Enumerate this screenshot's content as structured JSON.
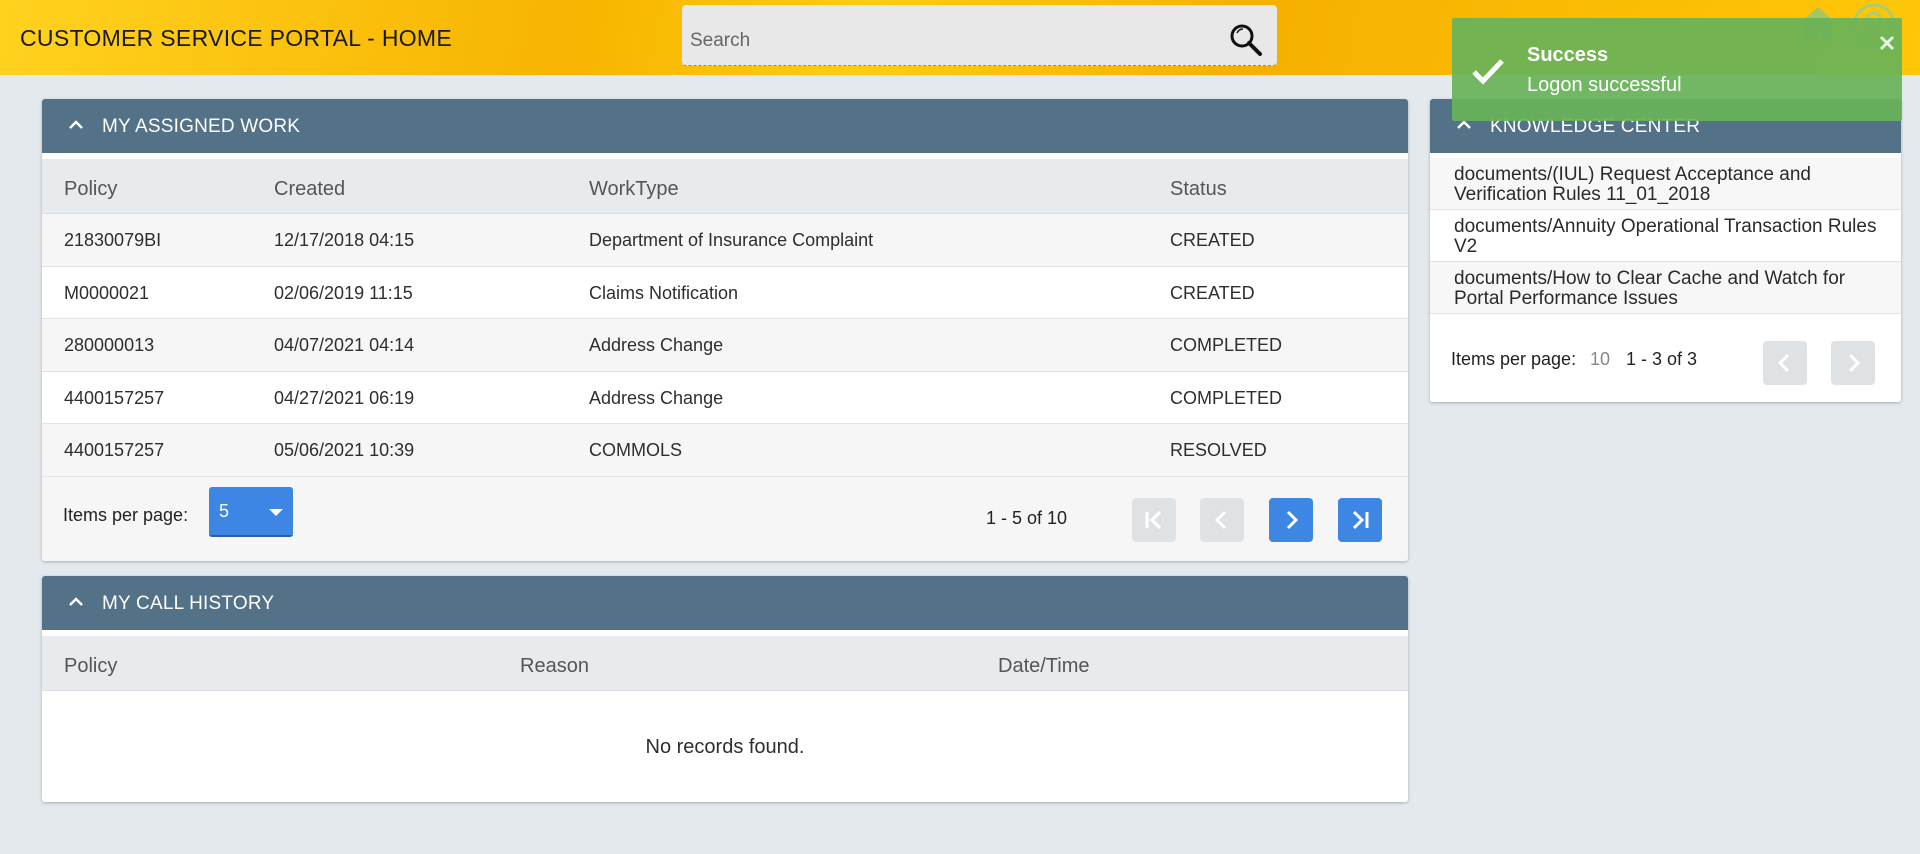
{
  "header": {
    "title": "CUSTOMER SERVICE PORTAL - HOME",
    "search_placeholder": "Search",
    "icons": [
      "search-icon",
      "home-icon",
      "user-icon"
    ]
  },
  "assigned_work": {
    "title": "MY ASSIGNED WORK",
    "columns": [
      "Policy",
      "Created",
      "WorkType",
      "Status"
    ],
    "rows": [
      [
        "21830079BI",
        "12/17/2018 04:15",
        "Department of Insurance Complaint",
        "CREATED"
      ],
      [
        "M0000021",
        "02/06/2019 11:15",
        "Claims Notification",
        "CREATED"
      ],
      [
        "280000013",
        "04/07/2021 04:14",
        "Address Change",
        "COMPLETED"
      ],
      [
        "4400157257",
        "04/27/2021 06:19",
        "Address Change",
        "COMPLETED"
      ],
      [
        "4400157257",
        "05/06/2021 10:39",
        "COMMOLS",
        "RESOLVED"
      ]
    ],
    "items_per_page_label": "Items per page:",
    "items_per_page_value": "5",
    "range": "1 - 5 of 10"
  },
  "call_history": {
    "title": "MY CALL HISTORY",
    "columns": [
      "Policy",
      "Reason",
      "Date/Time"
    ],
    "empty_text": "No records found."
  },
  "knowledge_center": {
    "title": "KNOWLEDGE CENTER",
    "items": [
      "documents/(IUL) Request Acceptance and Verification Rules 11_01_2018",
      "documents/Annuity Operational Transaction Rules V2",
      "documents/How to Clear Cache and Watch for Portal Performance Issues"
    ],
    "items_per_page_label": "Items per page:",
    "items_per_page_value": "10",
    "range": "1 - 3 of 3"
  },
  "toast": {
    "title": "Success",
    "message": "Logon successful"
  },
  "colors": {
    "header_yellow": "#f7b400",
    "panel_header": "#537187",
    "primary_button": "#3d86e4",
    "toast_green": "#68b258",
    "background": "#e4e9ee"
  }
}
